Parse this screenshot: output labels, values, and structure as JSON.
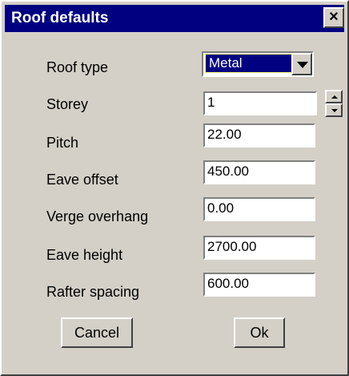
{
  "window": {
    "title": "Roof defaults",
    "close_label": "×"
  },
  "form": {
    "roof_type": {
      "label": "Roof type",
      "value": "Metal"
    },
    "storey": {
      "label": "Storey",
      "value": "1"
    },
    "pitch": {
      "label": "Pitch",
      "value": "22.00"
    },
    "eave_offset": {
      "label": "Eave offset",
      "value": "450.00"
    },
    "verge_overhang": {
      "label": "Verge overhang",
      "value": "0.00"
    },
    "eave_height": {
      "label": "Eave height",
      "value": "2700.00"
    },
    "rafter_spacing": {
      "label": "Rafter spacing",
      "value": "600.00"
    }
  },
  "buttons": {
    "cancel": "Cancel",
    "ok": "Ok"
  }
}
